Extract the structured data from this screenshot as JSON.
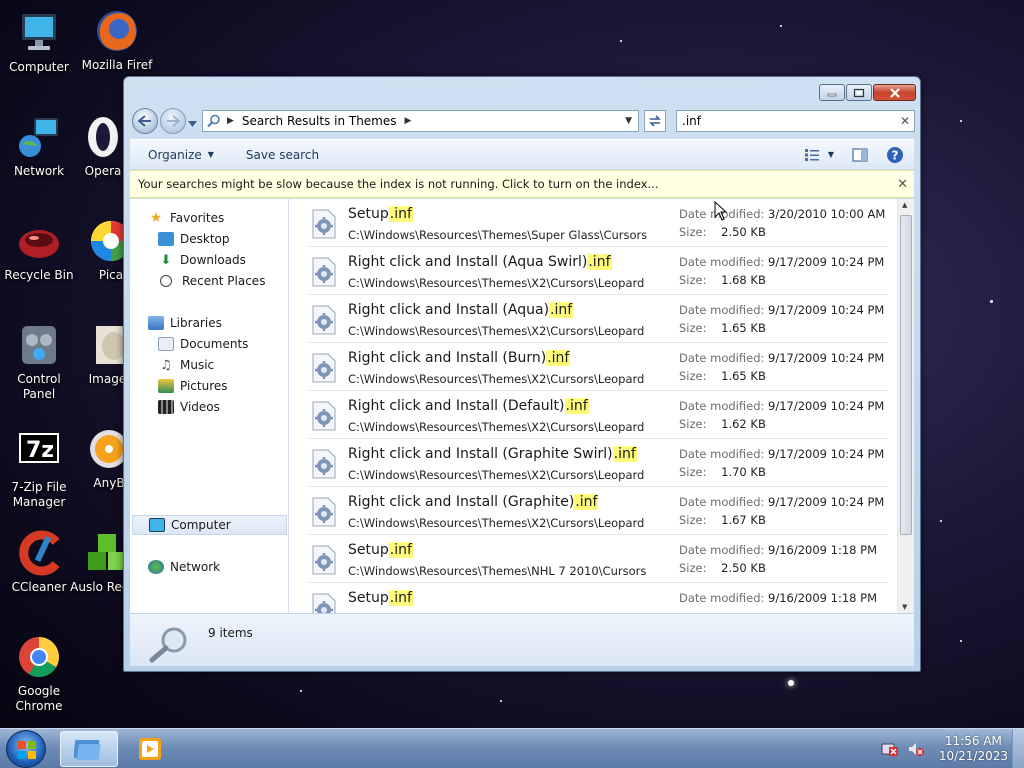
{
  "desktop_icons": [
    {
      "label": "Computer",
      "icon": "computer-icon"
    },
    {
      "label": "Mozilla Firef",
      "icon": "firefox-icon"
    },
    {
      "label": "Network",
      "icon": "network-icon"
    },
    {
      "label": "Opera",
      "icon": "opera-icon"
    },
    {
      "label": "Recycle Bin",
      "icon": "recycle-bin-icon"
    },
    {
      "label": "Pica",
      "icon": "picasa-icon"
    },
    {
      "label": "Control Panel",
      "icon": "control-panel-icon"
    },
    {
      "label": "Image T",
      "icon": "image-tuner-icon"
    },
    {
      "label": "7-Zip File Manager",
      "icon": "seven-zip-icon"
    },
    {
      "label": "AnyB",
      "icon": "anyburn-icon"
    },
    {
      "label": "CCleaner",
      "icon": "ccleaner-icon"
    },
    {
      "label": "Auslo Regist",
      "icon": "auslogics-icon"
    },
    {
      "label": "Google Chrome",
      "icon": "chrome-icon"
    }
  ],
  "window": {
    "address": {
      "segment": "Search Results in Themes"
    },
    "search": {
      "value": ".inf"
    },
    "toolbar": {
      "organize": "Organize",
      "save_search": "Save search"
    },
    "infobar": {
      "message": "Your searches might be slow because the index is not running.  Click to turn on the index..."
    },
    "nav": {
      "favorites": "Favorites",
      "desktop": "Desktop",
      "downloads": "Downloads",
      "recent_places": "Recent Places",
      "libraries": "Libraries",
      "documents": "Documents",
      "music": "Music",
      "pictures": "Pictures",
      "videos": "Videos",
      "computer": "Computer",
      "network": "Network"
    },
    "labels": {
      "date_modified": "Date modified:",
      "size": "Size:"
    },
    "results": [
      {
        "name": "Setup",
        "ext": ".inf",
        "path": "C:\\Windows\\Resources\\Themes\\Super Glass\\Cursors",
        "date": "3/20/2010 10:00 AM",
        "size": "2.50 KB"
      },
      {
        "name": "Right click and Install (Aqua Swirl)",
        "ext": ".inf",
        "path": "C:\\Windows\\Resources\\Themes\\X2\\Cursors\\Leopard",
        "date": "9/17/2009 10:24 PM",
        "size": "1.68 KB"
      },
      {
        "name": "Right click and Install (Aqua)",
        "ext": ".inf",
        "path": "C:\\Windows\\Resources\\Themes\\X2\\Cursors\\Leopard",
        "date": "9/17/2009 10:24 PM",
        "size": "1.65 KB"
      },
      {
        "name": "Right click and Install (Burn)",
        "ext": ".inf",
        "path": "C:\\Windows\\Resources\\Themes\\X2\\Cursors\\Leopard",
        "date": "9/17/2009 10:24 PM",
        "size": "1.65 KB"
      },
      {
        "name": "Right click and Install (Default)",
        "ext": ".inf",
        "path": "C:\\Windows\\Resources\\Themes\\X2\\Cursors\\Leopard",
        "date": "9/17/2009 10:24 PM",
        "size": "1.62 KB"
      },
      {
        "name": "Right click and Install (Graphite Swirl)",
        "ext": ".inf",
        "path": "C:\\Windows\\Resources\\Themes\\X2\\Cursors\\Leopard",
        "date": "9/17/2009 10:24 PM",
        "size": "1.70 KB"
      },
      {
        "name": "Right click and Install (Graphite)",
        "ext": ".inf",
        "path": "C:\\Windows\\Resources\\Themes\\X2\\Cursors\\Leopard",
        "date": "9/17/2009 10:24 PM",
        "size": "1.67 KB"
      },
      {
        "name": "Setup",
        "ext": ".inf",
        "path": "C:\\Windows\\Resources\\Themes\\NHL 7 2010\\Cursors",
        "date": "9/16/2009 1:18 PM",
        "size": "2.50 KB"
      },
      {
        "name": "Setup",
        "ext": ".inf",
        "path": "",
        "date": "9/16/2009 1:18 PM",
        "size": ""
      }
    ],
    "status": {
      "count": "9 items"
    }
  },
  "taskbar": {
    "clock_time": "11:56 AM",
    "clock_date": "10/21/2023"
  },
  "colors": {
    "highlight": "#fffa7a",
    "infobar": "#ffffe1",
    "accent": "#1e395b"
  }
}
